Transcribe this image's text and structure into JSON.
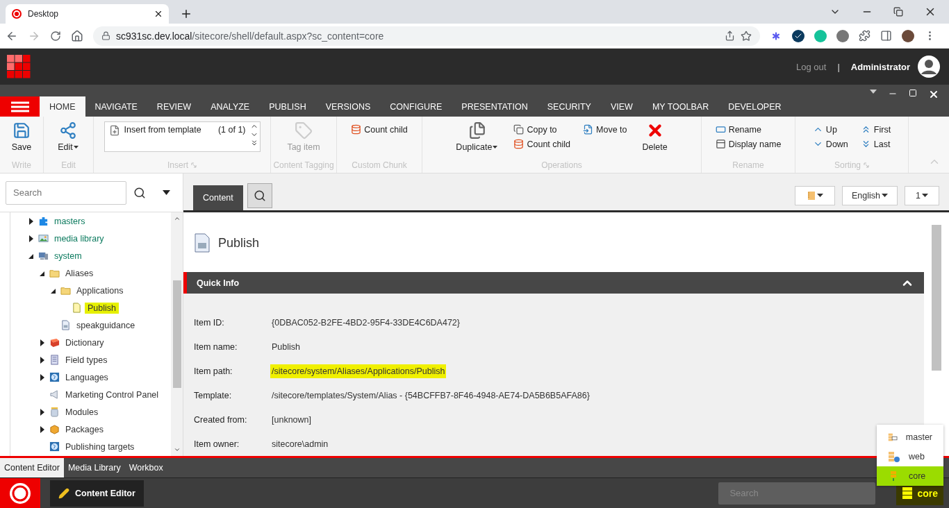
{
  "browser": {
    "tab_title": "Desktop",
    "url_host": "sc931sc.dev.local",
    "url_path": "/sitecore/shell/default.aspx?sc_content=core"
  },
  "header": {
    "logout": "Log out",
    "separator": "|",
    "user": "Administrator"
  },
  "ribbon_tabs": [
    {
      "label": "HOME",
      "selected": true
    },
    {
      "label": "NAVIGATE",
      "selected": false
    },
    {
      "label": "REVIEW",
      "selected": false
    },
    {
      "label": "ANALYZE",
      "selected": false
    },
    {
      "label": "PUBLISH",
      "selected": false
    },
    {
      "label": "VERSIONS",
      "selected": false
    },
    {
      "label": "CONFIGURE",
      "selected": false
    },
    {
      "label": "PRESENTATION",
      "selected": false
    },
    {
      "label": "SECURITY",
      "selected": false
    },
    {
      "label": "VIEW",
      "selected": false
    },
    {
      "label": "MY TOOLBAR",
      "selected": false
    },
    {
      "label": "DEVELOPER",
      "selected": false
    }
  ],
  "ribbon_groups": [
    {
      "label": "Write",
      "launcher": false,
      "items": [
        {
          "kind": "large",
          "label": "Save",
          "disabled": false
        }
      ]
    },
    {
      "label": "Edit",
      "launcher": false,
      "items": [
        {
          "kind": "large_menu",
          "label": "Edit",
          "disabled": false
        }
      ]
    },
    {
      "label": "Insert",
      "launcher": true,
      "items": [
        {
          "kind": "gallery",
          "label": "Insert from template",
          "count": "(1 of 1)",
          "disabled": false
        }
      ]
    },
    {
      "label": "Content Tagging",
      "launcher": false,
      "items": [
        {
          "kind": "large",
          "label": "Tag item",
          "disabled": true
        }
      ]
    },
    {
      "label": "Custom Chunk",
      "launcher": false,
      "items": [
        {
          "kind": "small",
          "label": "Count child",
          "disabled": false
        }
      ]
    },
    {
      "label": "Operations",
      "launcher": false,
      "items": [
        {
          "kind": "large_menu",
          "label": "Duplicate",
          "disabled": false
        },
        {
          "kind": "small",
          "label": "Copy to",
          "disabled": false
        },
        {
          "kind": "small",
          "label": "Count child",
          "disabled": false
        },
        {
          "kind": "small",
          "label": "Move to",
          "disabled": false
        },
        {
          "kind": "large",
          "label": "Delete",
          "disabled": false
        }
      ]
    },
    {
      "label": "Rename",
      "launcher": false,
      "items": [
        {
          "kind": "small",
          "label": "Rename",
          "disabled": false
        },
        {
          "kind": "small",
          "label": "Display name",
          "disabled": false
        }
      ]
    },
    {
      "label": "Sorting",
      "launcher": true,
      "items": [
        {
          "kind": "small",
          "label": "Up",
          "disabled": false
        },
        {
          "kind": "small",
          "label": "Down",
          "disabled": false
        },
        {
          "kind": "small",
          "label": "First",
          "disabled": false
        },
        {
          "kind": "small",
          "label": "Last",
          "disabled": false
        }
      ]
    }
  ],
  "sidebar": {
    "search_placeholder": "Search",
    "tree": [
      {
        "label": "masters",
        "kind": "puzzle",
        "expanded": false,
        "selected": false
      },
      {
        "label": "media library",
        "kind": "image",
        "expanded": false,
        "selected": false
      },
      {
        "label": "system",
        "kind": "computer",
        "expanded": true,
        "selected": false,
        "children": [
          {
            "label": "Aliases",
            "kind": "folder",
            "expanded": true,
            "selected": false,
            "children": [
              {
                "label": "Applications",
                "kind": "folder",
                "expanded": true,
                "selected": false,
                "children": [
                  {
                    "label": "Publish",
                    "kind": "document",
                    "selected": true
                  }
                ]
              },
              {
                "label": "speakguidance",
                "kind": "page",
                "selected": false
              }
            ]
          },
          {
            "label": "Dictionary",
            "kind": "book",
            "expanded": false,
            "selected": false
          },
          {
            "label": "Field types",
            "kind": "list",
            "expanded": false,
            "selected": false
          },
          {
            "label": "Languages",
            "kind": "globe",
            "expanded": false,
            "selected": false
          },
          {
            "label": "Marketing Control Panel",
            "kind": "megaphone",
            "selected": false
          },
          {
            "label": "Modules",
            "kind": "jar",
            "expanded": false,
            "selected": false
          },
          {
            "label": "Packages",
            "kind": "box",
            "expanded": false,
            "selected": false
          },
          {
            "label": "Publishing targets",
            "kind": "globe",
            "selected": false
          }
        ]
      }
    ]
  },
  "editor_tabs": [
    {
      "label": "Content",
      "selected": true
    }
  ],
  "editor_buttons": [
    {
      "kind": "icon"
    },
    {
      "kind": "text",
      "label": "English"
    },
    {
      "kind": "text",
      "label": "1"
    }
  ],
  "editor": {
    "title": "Publish",
    "section": {
      "title": "Quick Info",
      "expanded": true
    },
    "fields": [
      {
        "label": "Item ID:",
        "value": "{0DBAC052-B2FE-4BD2-95F4-33DE4C6DA472}",
        "highlighted": false
      },
      {
        "label": "Item name:",
        "value": "Publish",
        "highlighted": false
      },
      {
        "label": "Item path:",
        "value": "/sitecore/system/Aliases/Applications/Publish",
        "highlighted": true
      },
      {
        "label": "Template:",
        "value": "/sitecore/templates/System/Alias - {54BCFFB7-8F46-4948-AE74-DA5B6B5AFA86}",
        "highlighted": false
      },
      {
        "label": "Created from:",
        "value": "[unknown]",
        "highlighted": false
      },
      {
        "label": "Item owner:",
        "value": "sitecore\\admin",
        "highlighted": false
      }
    ]
  },
  "bottom_tabs": [
    {
      "label": "Content Editor",
      "selected": true
    },
    {
      "label": "Media Library",
      "selected": false
    },
    {
      "label": "Workbox",
      "selected": false
    }
  ],
  "taskbar": {
    "app": "Content Editor",
    "search_placeholder": "Search",
    "database": "core"
  },
  "database_menu": [
    {
      "label": "master",
      "kind": "master",
      "selected": false
    },
    {
      "label": "web",
      "kind": "web",
      "selected": false
    },
    {
      "label": "core",
      "kind": "core",
      "selected": true
    }
  ]
}
